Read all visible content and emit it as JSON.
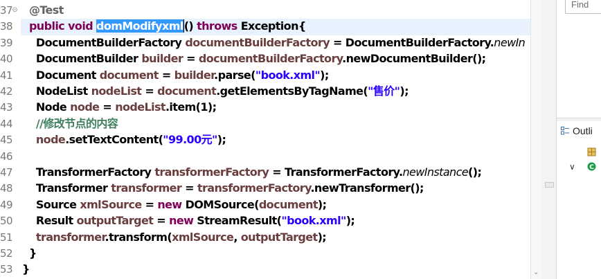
{
  "editor": {
    "line_numbers": [
      "37",
      "38",
      "39",
      "40",
      "41",
      "42",
      "43",
      "44",
      "45",
      "46",
      "47",
      "48",
      "49",
      "50",
      "51",
      "52",
      "53"
    ],
    "lines": [
      [
        {
          "t": "  ",
          "c": ""
        },
        {
          "t": "@Test",
          "c": "ann"
        }
      ],
      [
        {
          "t": "  ",
          "c": ""
        },
        {
          "t": "public",
          "c": "kw"
        },
        {
          "t": " ",
          "c": ""
        },
        {
          "t": "void",
          "c": "kw"
        },
        {
          "t": " ",
          "c": ""
        },
        {
          "t": "domModifyxml",
          "c": "sel"
        },
        {
          "t": "() ",
          "c": "caretafter"
        },
        {
          "t": "throws",
          "c": "kw"
        },
        {
          "t": " Exception{",
          "c": ""
        }
      ],
      [
        {
          "t": "    DocumentBuilderFactory ",
          "c": ""
        },
        {
          "t": "documentBuilderFactory",
          "c": "var"
        },
        {
          "t": " = DocumentBuilderFactory.",
          "c": ""
        },
        {
          "t": "newIn",
          "c": "it"
        }
      ],
      [
        {
          "t": "    DocumentBuilder ",
          "c": ""
        },
        {
          "t": "builder",
          "c": "var"
        },
        {
          "t": " = ",
          "c": ""
        },
        {
          "t": "documentBuilderFactory",
          "c": "var"
        },
        {
          "t": ".newDocumentBuilder();",
          "c": ""
        }
      ],
      [
        {
          "t": "    Document ",
          "c": ""
        },
        {
          "t": "document",
          "c": "var"
        },
        {
          "t": " = ",
          "c": ""
        },
        {
          "t": "builder",
          "c": "var"
        },
        {
          "t": ".parse(",
          "c": ""
        },
        {
          "t": "\"book.xml\"",
          "c": "str"
        },
        {
          "t": ");",
          "c": ""
        }
      ],
      [
        {
          "t": "    NodeList ",
          "c": ""
        },
        {
          "t": "nodeList",
          "c": "var"
        },
        {
          "t": " = ",
          "c": ""
        },
        {
          "t": "document",
          "c": "var"
        },
        {
          "t": ".getElementsByTagName(",
          "c": ""
        },
        {
          "t": "\"售价\"",
          "c": "str"
        },
        {
          "t": ");",
          "c": ""
        }
      ],
      [
        {
          "t": "    Node ",
          "c": ""
        },
        {
          "t": "node",
          "c": "var"
        },
        {
          "t": " = ",
          "c": ""
        },
        {
          "t": "nodeList",
          "c": "var"
        },
        {
          "t": ".item(1);",
          "c": ""
        }
      ],
      [
        {
          "t": "    ",
          "c": ""
        },
        {
          "t": "//修改节点的内容",
          "c": "cm"
        }
      ],
      [
        {
          "t": "    ",
          "c": ""
        },
        {
          "t": "node",
          "c": "var"
        },
        {
          "t": ".setTextContent(",
          "c": ""
        },
        {
          "t": "\"99.00元\"",
          "c": "str"
        },
        {
          "t": ");",
          "c": ""
        }
      ],
      [
        {
          "t": "",
          "c": ""
        }
      ],
      [
        {
          "t": "    TransformerFactory ",
          "c": ""
        },
        {
          "t": "transformerFactory",
          "c": "var"
        },
        {
          "t": " = TransformerFactory.",
          "c": ""
        },
        {
          "t": "newInstance",
          "c": "it"
        },
        {
          "t": "();",
          "c": ""
        }
      ],
      [
        {
          "t": "    Transformer ",
          "c": ""
        },
        {
          "t": "transformer",
          "c": "var"
        },
        {
          "t": " = ",
          "c": ""
        },
        {
          "t": "transformerFactory",
          "c": "var"
        },
        {
          "t": ".newTransformer();",
          "c": ""
        }
      ],
      [
        {
          "t": "    Source ",
          "c": ""
        },
        {
          "t": "xmlSource",
          "c": "var"
        },
        {
          "t": " = ",
          "c": ""
        },
        {
          "t": "new",
          "c": "kw"
        },
        {
          "t": " DOMSource(",
          "c": ""
        },
        {
          "t": "document",
          "c": "var"
        },
        {
          "t": ");",
          "c": ""
        }
      ],
      [
        {
          "t": "    Result ",
          "c": ""
        },
        {
          "t": "outputTarget",
          "c": "var"
        },
        {
          "t": " = ",
          "c": ""
        },
        {
          "t": "new",
          "c": "kw"
        },
        {
          "t": " StreamResult(",
          "c": ""
        },
        {
          "t": "\"book.xml\"",
          "c": "str"
        },
        {
          "t": ");",
          "c": ""
        }
      ],
      [
        {
          "t": "    ",
          "c": ""
        },
        {
          "t": "transformer",
          "c": "var"
        },
        {
          "t": ".transform(",
          "c": ""
        },
        {
          "t": "xmlSource",
          "c": "var"
        },
        {
          "t": ", ",
          "c": ""
        },
        {
          "t": "outputTarget",
          "c": "var"
        },
        {
          "t": ");",
          "c": ""
        }
      ],
      [
        {
          "t": "  }",
          "c": ""
        }
      ],
      [
        {
          "t": "}",
          "c": ""
        }
      ]
    ]
  },
  "find": {
    "placeholder": "Find"
  },
  "outline": {
    "label": "Outli"
  },
  "colors": {
    "keyword": "#7f0055",
    "variable": "#6a3e3e",
    "string": "#2a00ff",
    "comment": "#3f7f5f",
    "selection": "#3399ff",
    "current_line": "#e8f2fe"
  },
  "icons": [
    "fold-collapse-icon",
    "outline-view-icon",
    "package-icon",
    "chevron-down-icon",
    "class-icon",
    "scroll-down-arrow-icon"
  ]
}
